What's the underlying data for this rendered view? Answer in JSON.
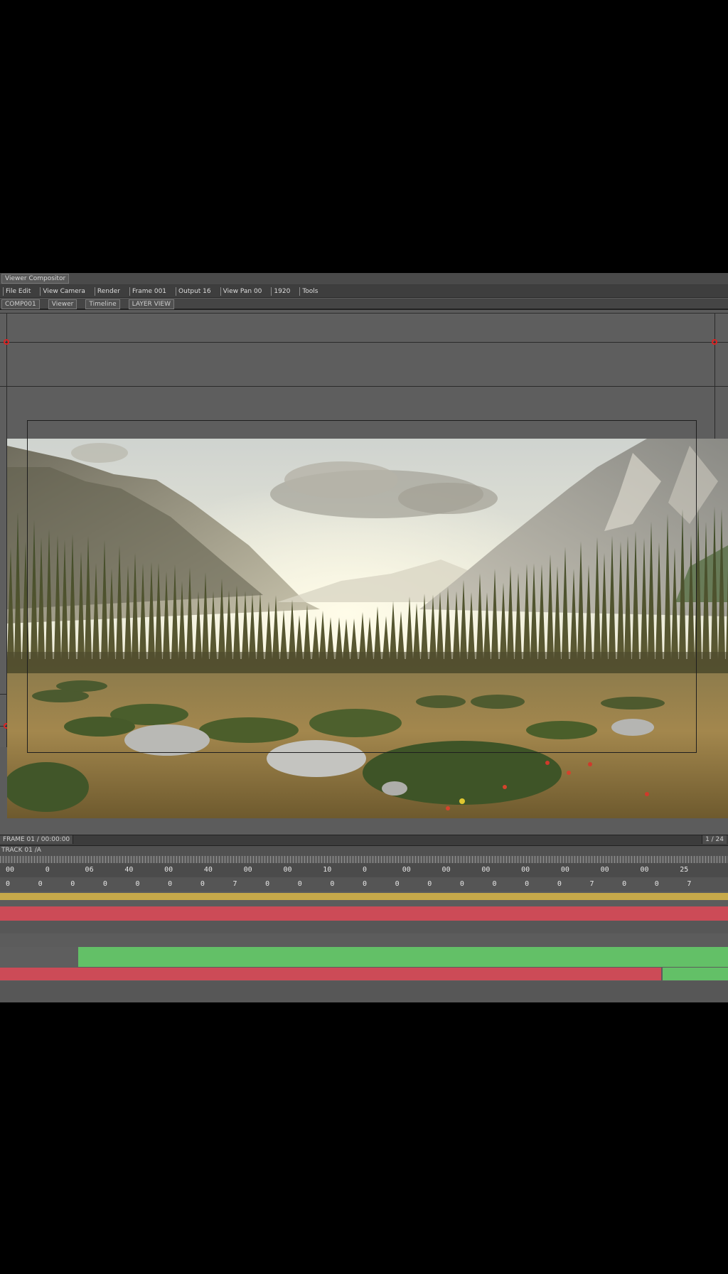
{
  "app": {
    "title": "Viewer Compositor",
    "toolbar": [
      "File Edit",
      "View Camera",
      "Render",
      "Frame 001",
      "Output 16",
      "View Pan 00",
      "1920",
      "Tools"
    ],
    "tabs": [
      "COMP001",
      "Viewer",
      "Timeline",
      "LAYER VIEW"
    ]
  },
  "viewer": {
    "image": "alpine meadow landscape render"
  },
  "transport": {
    "left_label": "FRAME 01 / 00:00:00",
    "right_label": "1 / 24"
  },
  "timeline": {
    "track_label": "TRACK 01 /A",
    "ruler_top": [
      "00",
      "0",
      "06",
      "40",
      "00",
      "40",
      "00",
      "00",
      "10",
      "0",
      "00",
      "00",
      "00",
      "00",
      "00",
      "00",
      "00",
      "25"
    ],
    "ruler_bottom": [
      "0",
      "0",
      "0",
      "0",
      "0",
      "0",
      "0",
      "7",
      "0",
      "0",
      "0",
      "0",
      "0",
      "0",
      "0",
      "0",
      "0",
      "0",
      "7",
      "0",
      "0",
      "7"
    ]
  },
  "colors": {
    "clip_yellow": "#c7a94a",
    "clip_red": "#cc4b57",
    "clip_green": "#63c067"
  }
}
